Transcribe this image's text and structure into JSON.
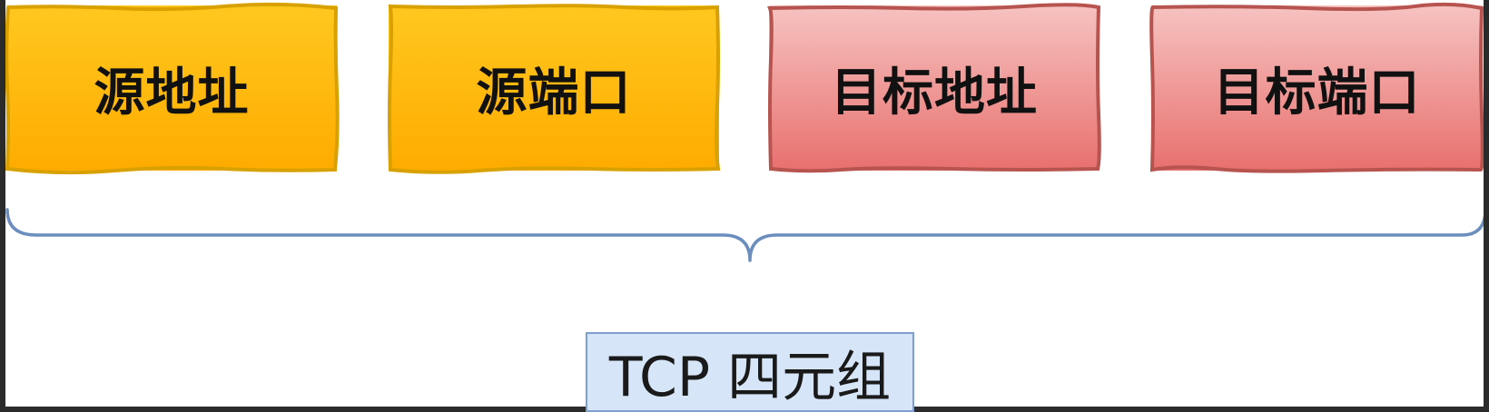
{
  "diagram": {
    "boxes": [
      {
        "label": "源地址",
        "group": "source",
        "fill": "#ffbf00",
        "stroke": "#d9a100"
      },
      {
        "label": "源端口",
        "group": "source",
        "fill": "#ffbf00",
        "stroke": "#d9a100"
      },
      {
        "label": "目标地址",
        "group": "destination",
        "fill": "#ef9a98",
        "stroke": "#b85450"
      },
      {
        "label": "目标端口",
        "group": "destination",
        "fill": "#ef9a98",
        "stroke": "#b85450"
      }
    ],
    "brace_color": "#6c8ebf",
    "caption": "TCP 四元组",
    "caption_fill": "#dae8fc",
    "caption_stroke": "#6c8ebf"
  }
}
